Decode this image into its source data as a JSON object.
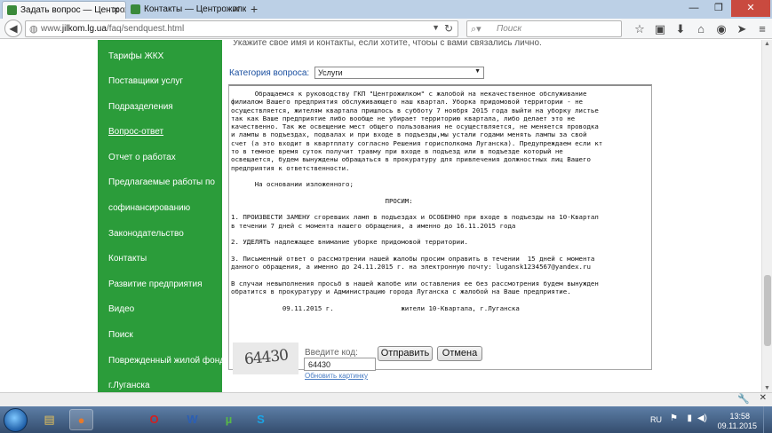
{
  "browser": {
    "tabs": [
      {
        "title": "Задать вопрос — Центрожилк..."
      },
      {
        "title": "Контакты — Центрожилком"
      }
    ],
    "new_tab_label": "+",
    "url_prefix": "www.",
    "url_host": "jilkom.lg.ua",
    "url_path": "/faq/sendquest.html",
    "search_placeholder": "Поиск"
  },
  "sidebar": {
    "items": [
      {
        "label": "Тарифы ЖКХ"
      },
      {
        "label": "Поставщики услуг"
      },
      {
        "label": "Подразделения"
      },
      {
        "label": "Вопрос-ответ"
      },
      {
        "label": "Отчет о работах"
      },
      {
        "label": "Предлагаемые работы по"
      },
      {
        "label": "софинансированию"
      },
      {
        "label": "Законодательство"
      },
      {
        "label": "Контакты"
      },
      {
        "label": "Развитие предприятия"
      },
      {
        "label": "Видео"
      },
      {
        "label": "Поиск"
      },
      {
        "label": "Поврежденный жилой фонд"
      },
      {
        "label": "г.Луганска"
      }
    ]
  },
  "form": {
    "top_hint": "Укажите свое имя и контакты, если хотите, чтобы с вами связались лично.",
    "category_label": "Категория вопроса:",
    "category_value": "Услуги",
    "message_text": "      Обращаемся к руководству ГКП \"Центрожилком\" с жалобой на некачественное обслуживание\nфилиалом Вашего предприятия обслуживающего наш квартал. Уборка придомовой территории - не\nосуществляется, жителям квартала пришлось в субботу 7 ноября 2015 года выйти на уборку листье\nтак как Ваше предприятие либо вообще не убирает территорию квартала, либо делает это не\nкачественно. Так же освещение мест общего пользования не осуществляется, не меняется проводка\nи лампы в подъездах, подвалах и при входе в подъезды,мы устали годами менять лампы за свой\nсчет (а это входит в квартплату согласно Решения горисполкома Луганска). Предупреждаем если кт\nто в темное время суток получит травму при входе в подъезд или в подъезде который не\nосвещается, будем вынуждены обращаться в прокуратуру для привлечения должностных лиц Вашего\nпредприятия к ответственности.\n\n      На основании изложенного;\n\n                                       ПРОСИМ:\n\n1. ПРОИЗВЕСТИ ЗАМЕНУ сгоревших ламп в подъездах и ОСОБЕННО при входе в подъезды на 10-Квартал\nв течении 7 дней с момента нашего обращения, а именно до 16.11.2015 года\n\n2. УДЕЛЯТЬ надлежащее внимание уборке придомовой территории.\n\n3. Письменный ответ о рассмотрении нашей жалобы просим оправить в течении  15 дней с момента\nданного обращения, а именно до 24.11.2015 г. на электронную почту: lugansk1234567@yandex.ru\n\nВ случаи невыполнения просьб в нашей жалобе или оставления ее без рассмотрения будем вынужден\nобратится в прокуратуру и Администрацию города Луганска с жалобой на Ваше предприятие.\n\n             09.11.2015 г.                 жители 10-Квартала, г.Луганска",
    "captcha_text": "64430",
    "code_label": "Введите код:",
    "code_value": "64430",
    "refresh_link": "Обновить картинку",
    "submit_label": "Отправить",
    "cancel_label": "Отмена"
  },
  "taskbar": {
    "apps": [
      {
        "icon": "explorer-icon",
        "glyph": "▤",
        "color": "#e8c35a"
      },
      {
        "icon": "firefox-icon",
        "glyph": "●",
        "color": "#e87a2a",
        "active": true
      },
      {
        "icon": "opera-icon",
        "glyph": "O",
        "color": "#d32020"
      },
      {
        "icon": "word-icon",
        "glyph": "W",
        "color": "#2b5fb4"
      },
      {
        "icon": "utorrent-icon",
        "glyph": "µ",
        "color": "#58b947"
      },
      {
        "icon": "skype-icon",
        "glyph": "S",
        "color": "#1aa5e6"
      }
    ],
    "lang": "RU",
    "time": "13:58",
    "date": "09.11.2015"
  }
}
